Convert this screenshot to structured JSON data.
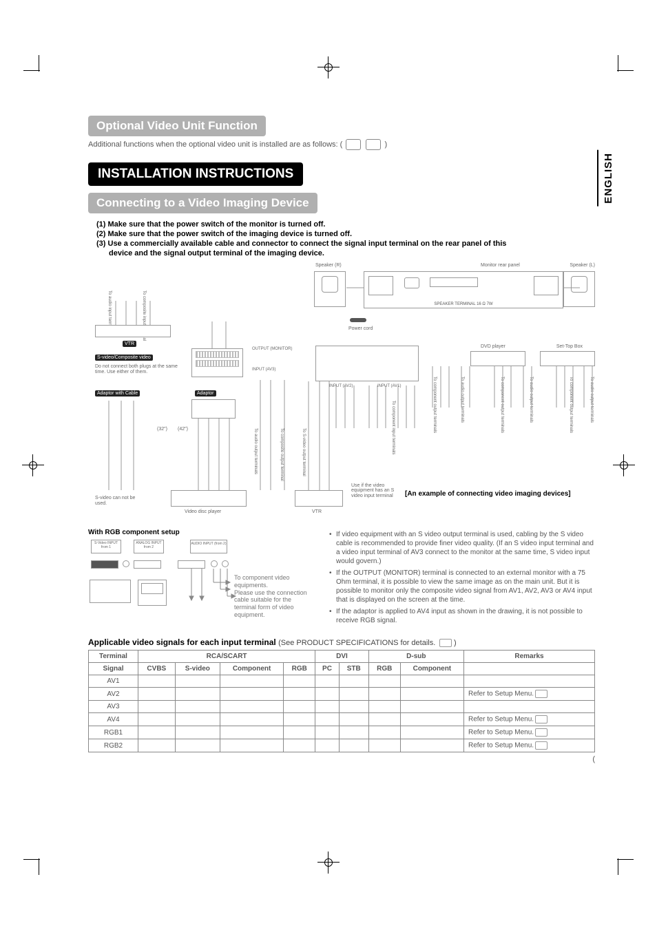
{
  "lang_tab": "ENGLISH",
  "h_optional": "Optional Video Unit Function",
  "intro": "Additional functions when the optional video unit is installed are as follows: (",
  "intro_end": ")",
  "h_install": "INSTALLATION INSTRUCTIONS",
  "h_connect": "Connecting to a Video Imaging Device",
  "steps": {
    "s1": "(1) Make sure that the power switch of the monitor is turned off.",
    "s2": "(2) Make sure that the power switch of the imaging device is turned off.",
    "s3": "(3) Use a commercially available cable and connector to connect the signal input terminal on the rear panel of this",
    "s3b": "device and the signal output terminal of the imaging device."
  },
  "diagram": {
    "speaker_r": "Speaker (R)",
    "speaker_l": "Speaker (L)",
    "monitor_rear": "Monitor rear panel",
    "vtr": "VTR",
    "svideo_comp": "S-video/Composite video",
    "do_not": "Do not connect both plugs at the same time. Use either of them.",
    "adaptor_cable": "Adaptor with Cable",
    "adaptor": "Adaptor",
    "size_32": "(32\")",
    "size_42": "(42\")",
    "output_monitor": "OUTPUT (MONITOR)",
    "input_av3": "INPUT (AV3)",
    "input_av2": "INPUT (AV2)",
    "input_av1": "INPUT (AV1)",
    "svideo_cannot": "S-video can not be used.",
    "video_disc": "Video disc player",
    "dvd_player": "DVD player",
    "settop": "Set-Top Box",
    "power_cord": "Power cord",
    "example": "[An example of connecting video imaging devices]",
    "use_if": "Use if the video equipment has an S video input terminal",
    "to_audio_in": "To audio input terminals",
    "to_composite_in": "To composite input terminal",
    "to_component_in": "To component input terminals",
    "to_component_out": "To component output terminals",
    "to_audio_out": "To audio output terminals",
    "to_svideo_out": "To S-video output terminal",
    "to_composite_out": "To composite output terminal",
    "speaker_term": "SPEAKER TERMINAL 16 Ω 7W"
  },
  "rgb_title": "With RGB component setup",
  "rgb_note1": "To component video equipments.",
  "rgb_note2": "Please use the connection cable suitable for the terminal form of video equipment.",
  "rgb_labels": {
    "svideo_in1": "S-Video INPUT from 1",
    "svideo_in2": "ANALOG INPUT from 2",
    "audio_in": "AUDIO INPUT (from 2)"
  },
  "bullets": {
    "b1": "If video equipment with an S video output terminal is used, cabling by the S video cable is recommended to provide finer video quality. (If an S video input terminal and a video input terminal of AV3 connect to the monitor at the same time, S video input would govern.)",
    "b2": "If the OUTPUT (MONITOR) terminal is connected to an external monitor with a 75 Ohm terminal, it is possible to view the same image as on the main unit. But it is possible to monitor only the composite video signal from AV1, AV2, AV3 or AV4 input that is displayed on the screen at the time.",
    "b3": "If the adaptor is applied to AV4 input as shown in the drawing, it is not possible to receive RGB signal."
  },
  "table_title": "Applicable video signals for each input terminal",
  "table_sub": "(See PRODUCT SPECIFICATIONS for details.",
  "table_sub_end": ")",
  "table": {
    "headers": {
      "terminal": "Terminal",
      "rca": "RCA/SCART",
      "dvi": "DVI",
      "dsub": "D-sub",
      "remarks": "Remarks",
      "signal": "Signal",
      "cvbs": "CVBS",
      "svideo": "S-video",
      "component": "Component",
      "rgb": "RGB",
      "pc": "PC",
      "stb": "STB"
    },
    "rows": [
      {
        "t": "AV1",
        "r": ""
      },
      {
        "t": "AV2",
        "r": "Refer to Setup Menu."
      },
      {
        "t": "AV3",
        "r": ""
      },
      {
        "t": "AV4",
        "r": "Refer to Setup Menu."
      },
      {
        "t": "RGB1",
        "r": "Refer to Setup Menu."
      },
      {
        "t": "RGB2",
        "r": "Refer to Setup Menu."
      }
    ]
  },
  "paren": "("
}
